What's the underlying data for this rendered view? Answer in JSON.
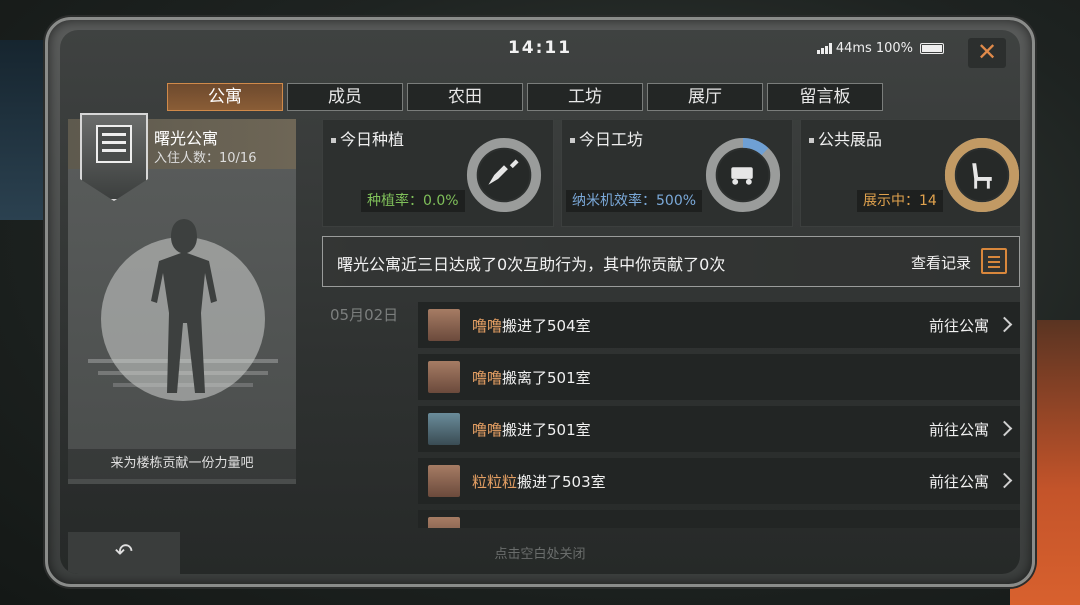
{
  "status": {
    "time": "14:11",
    "ping": "44ms",
    "battery": "100%"
  },
  "tabs": [
    {
      "label": "公寓",
      "active": true
    },
    {
      "label": "成员",
      "active": false
    },
    {
      "label": "农田",
      "active": false
    },
    {
      "label": "工坊",
      "active": false
    },
    {
      "label": "展厅",
      "active": false
    },
    {
      "label": "留言板",
      "active": false
    }
  ],
  "apartment": {
    "name": "曙光公寓",
    "occupancy": "入住人数：10/16",
    "contribute_prompt": "来为楼栋贡献一份力量吧"
  },
  "stats": [
    {
      "title": "今日种植",
      "value": "种植率：0.0%",
      "value_color": "#7fbf5a",
      "ring_fraction": 0.0,
      "ring_color": "#7fbf5a",
      "icon": "shovel-icon"
    },
    {
      "title": "今日工坊",
      "value": "纳米机效率：500%",
      "value_color": "#7aa8d8",
      "ring_fraction": 0.12,
      "ring_color": "#6fa0d4",
      "icon": "nano-machine-icon"
    },
    {
      "title": "公共展品",
      "value": "展示中：14",
      "value_color": "#e0a24e",
      "ring_fraction": 1.0,
      "ring_color": "#c29a64",
      "icon": "chair-icon"
    }
  ],
  "cooperation": {
    "text": "曙光公寓近三日达成了0次互助行为，其中你贡献了0次",
    "link": "查看记录"
  },
  "feed": {
    "date": "05月02日",
    "items": [
      {
        "name": "噜噜",
        "action": "搬进了504室",
        "go": "前往公寓"
      },
      {
        "name": "噜噜",
        "action": "搬离了501室",
        "go": ""
      },
      {
        "name": "噜噜",
        "action": "搬进了501室",
        "go": "前往公寓"
      },
      {
        "name": "粒粒粒",
        "action": "搬进了503室",
        "go": "前往公寓"
      }
    ]
  },
  "footer": {
    "back_icon": "return-arrow-icon",
    "hint": "点击空白处关闭"
  },
  "colors": {
    "accent": "#d8873c",
    "tab_active": "#8a5d36",
    "name_highlight": "#e6a064"
  }
}
